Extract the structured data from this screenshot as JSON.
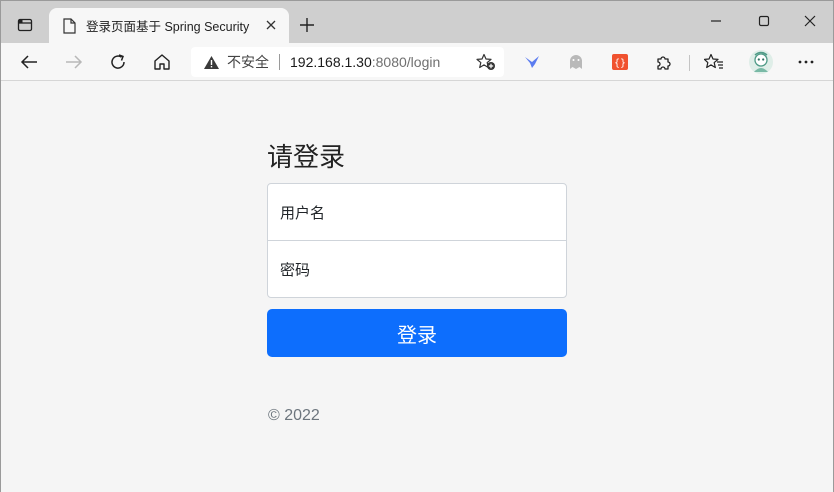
{
  "browser": {
    "tab_title": "登录页面基于 Spring Security",
    "address_bar": {
      "security_label": "不安全",
      "url_host": "192.168.1.30",
      "url_port_path": ":8080/login"
    },
    "icons": {
      "tab_actions": "tab-actions-icon",
      "favicon": "page-icon",
      "tab_close": "close-icon",
      "new_tab": "plus-icon",
      "minimize": "minimize-icon",
      "maximize": "maximize-icon",
      "close_window": "close-icon",
      "back": "back-arrow-icon",
      "forward": "forward-arrow-icon",
      "refresh": "refresh-icon",
      "home": "home-icon",
      "warning": "warning-icon",
      "favorite_add": "star-plus-icon",
      "extensions": [
        "bird-extension-icon",
        "ghost-extension-icon",
        "json-extension-icon",
        "puzzle-icon"
      ],
      "favorites": "favorites-icon",
      "profile": "avatar-icon",
      "more": "more-icon"
    }
  },
  "login": {
    "heading": "请登录",
    "username_placeholder": "用户名",
    "password_placeholder": "密码",
    "submit_label": "登录",
    "footer": "© 2022"
  },
  "colors": {
    "primary": "#0d6efd",
    "page_background": "#f5f5f5",
    "muted_text": "#6c757d"
  }
}
